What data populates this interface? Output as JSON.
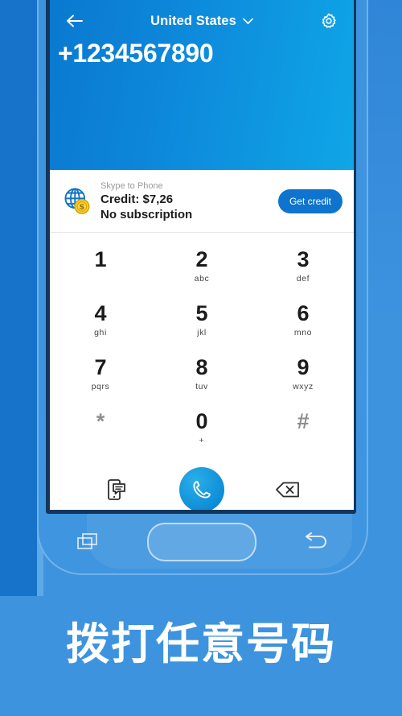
{
  "app": {
    "header": {
      "back_icon": "arrow-left-icon",
      "country": "United States",
      "dropdown_icon": "chevron-down-icon",
      "settings_icon": "gear-icon",
      "phone_number": "+1234567890"
    },
    "credit_bar": {
      "globe_icon": "globe-coin-icon",
      "label": "Skype to Phone",
      "credit": "Credit: $7,26",
      "subscription": "No subscription",
      "get_credit_label": "Get credit"
    },
    "dialpad": {
      "keys": [
        {
          "digit": "1",
          "letters": ""
        },
        {
          "digit": "2",
          "letters": "abc"
        },
        {
          "digit": "3",
          "letters": "def"
        },
        {
          "digit": "4",
          "letters": "ghi"
        },
        {
          "digit": "5",
          "letters": "jkl"
        },
        {
          "digit": "6",
          "letters": "mno"
        },
        {
          "digit": "7",
          "letters": "pqrs"
        },
        {
          "digit": "8",
          "letters": "tuv"
        },
        {
          "digit": "9",
          "letters": "wxyz"
        },
        {
          "digit": "*",
          "letters": ""
        },
        {
          "digit": "0",
          "letters": "+"
        },
        {
          "digit": "#",
          "letters": ""
        }
      ]
    },
    "actions": {
      "sms_icon": "phone-message-icon",
      "call_icon": "phone-handset-icon",
      "backspace_icon": "backspace-delete-icon"
    },
    "navbar": {
      "recents_icon": "recents-squares-icon",
      "home_icon": "home-pill-icon",
      "back_icon": "nav-back-arrow-icon"
    }
  },
  "promo": {
    "headline": "拨打任意号码"
  },
  "colors": {
    "background_blue": "#3d93de",
    "header_blue_dark": "#0a79d0",
    "header_blue_light": "#0fa6e6",
    "button_blue": "#0f74cd",
    "call_blue": "#0c8bd6",
    "coin_yellow": "#f5c518",
    "text_dark": "#1b1b1b",
    "text_muted": "#9a9a9a"
  }
}
